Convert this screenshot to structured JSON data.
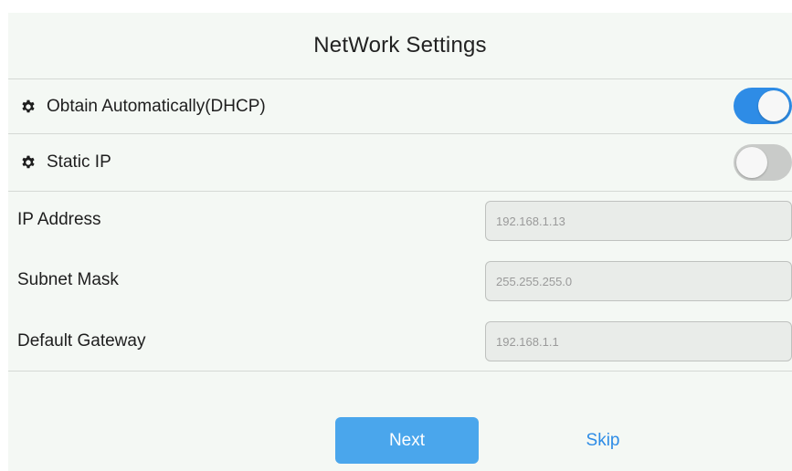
{
  "title": "NetWork Settings",
  "options": {
    "dhcp": {
      "label": "Obtain Automatically(DHCP)",
      "enabled": true,
      "icon": "gear-icon"
    },
    "static": {
      "label": "Static IP",
      "enabled": false,
      "icon": "gear-icon"
    }
  },
  "fields": {
    "ip_address": {
      "label": "IP Address",
      "placeholder": "192.168.1.13"
    },
    "subnet_mask": {
      "label": "Subnet Mask",
      "placeholder": "255.255.255.0"
    },
    "default_gateway": {
      "label": "Default Gateway",
      "placeholder": "192.168.1.1"
    }
  },
  "actions": {
    "next_label": "Next",
    "skip_label": "Skip"
  },
  "colors": {
    "accent": "#2e8ce6",
    "button": "#4aa6ec",
    "background": "#f4f8f4",
    "toggle_off": "#c9cbc9"
  }
}
